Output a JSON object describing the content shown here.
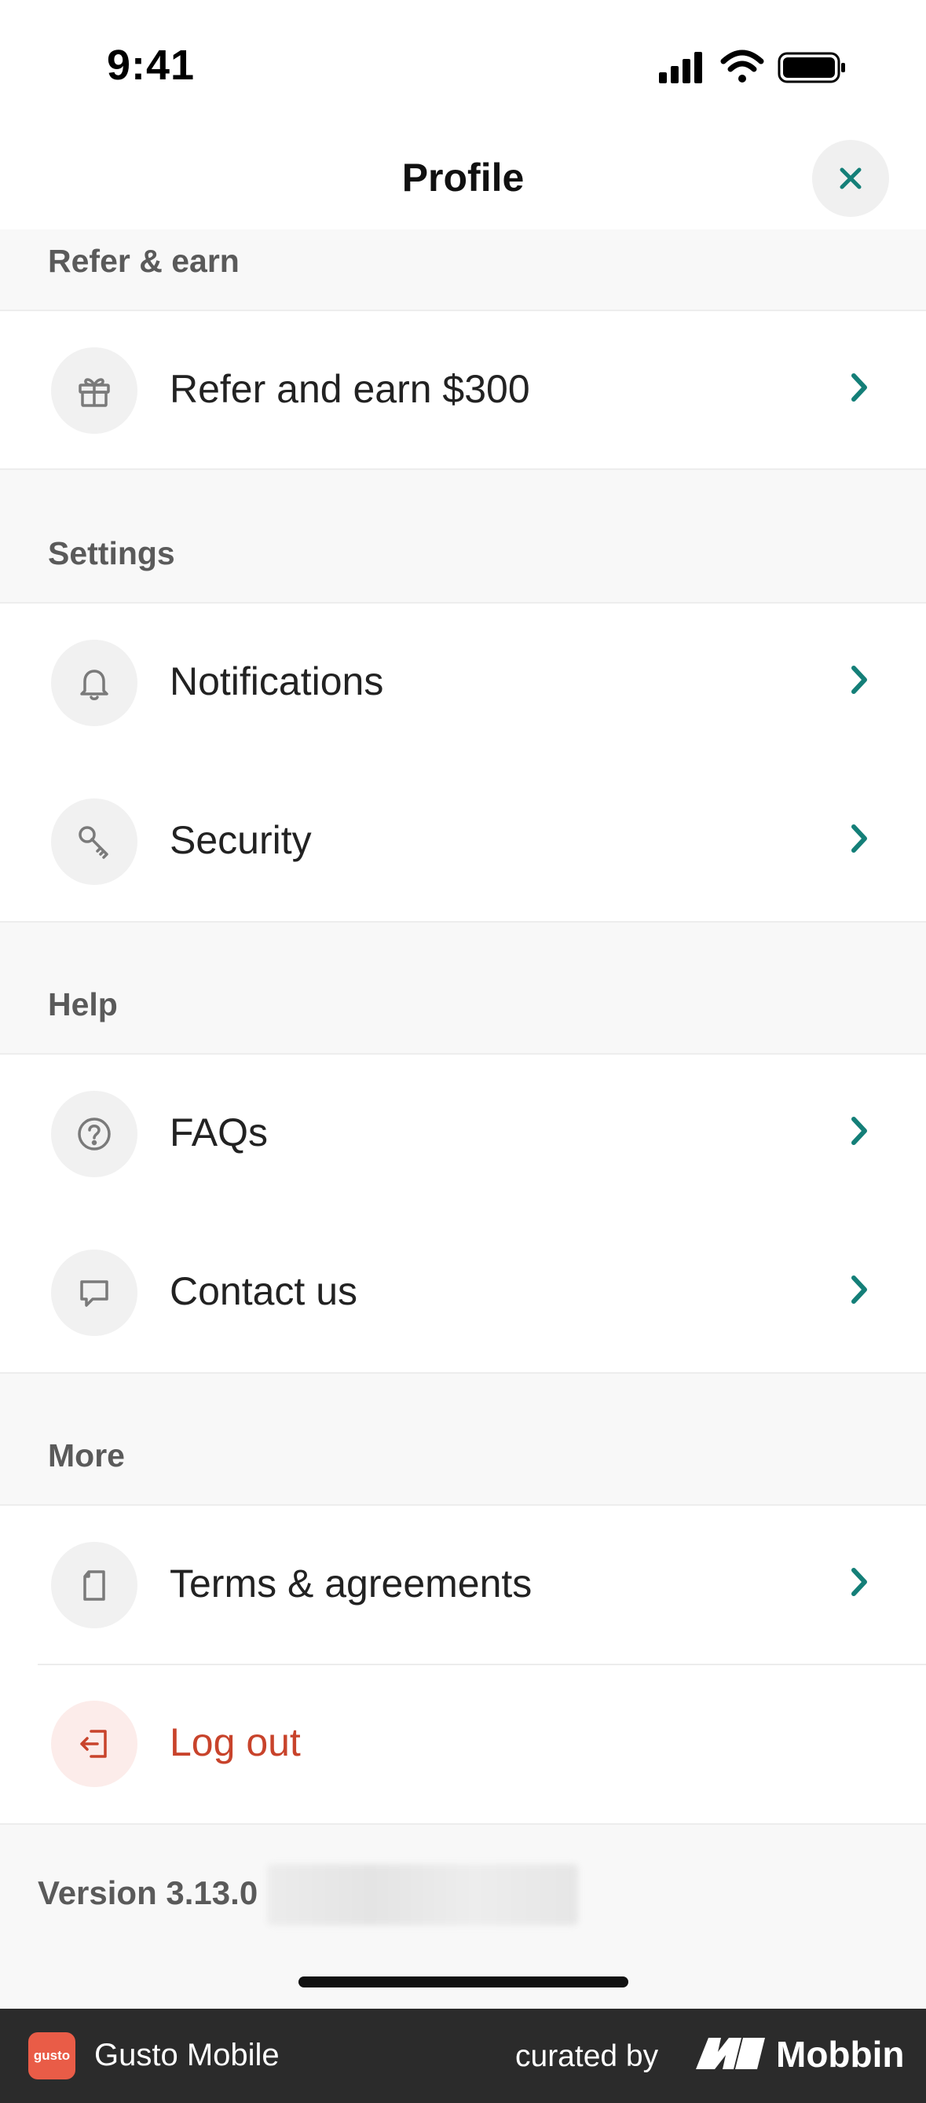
{
  "status_bar": {
    "time": "9:41"
  },
  "header": {
    "title": "Profile"
  },
  "sections": {
    "refer": {
      "label": "Refer & earn",
      "items": [
        {
          "label": "Refer and earn $300",
          "icon": "gift-icon"
        }
      ]
    },
    "settings": {
      "label": "Settings",
      "items": [
        {
          "label": "Notifications",
          "icon": "bell-icon"
        },
        {
          "label": "Security",
          "icon": "key-icon"
        }
      ]
    },
    "help": {
      "label": "Help",
      "items": [
        {
          "label": "FAQs",
          "icon": "question-icon"
        },
        {
          "label": "Contact us",
          "icon": "chat-bubble-icon"
        }
      ]
    },
    "more": {
      "label": "More",
      "items": [
        {
          "label": "Terms & agreements",
          "icon": "document-icon"
        },
        {
          "label": "Log out",
          "icon": "logout-icon"
        }
      ]
    }
  },
  "version": {
    "label": "Version 3.13.0"
  },
  "footer": {
    "logo_text": "gusto",
    "app_name": "Gusto Mobile",
    "curated_by": "curated by",
    "brand": "Mobbin"
  },
  "colors": {
    "accent": "#147f78",
    "danger": "#c8432b",
    "section_bg": "#f8f8f8",
    "footer_bg": "#2b2b2b"
  }
}
